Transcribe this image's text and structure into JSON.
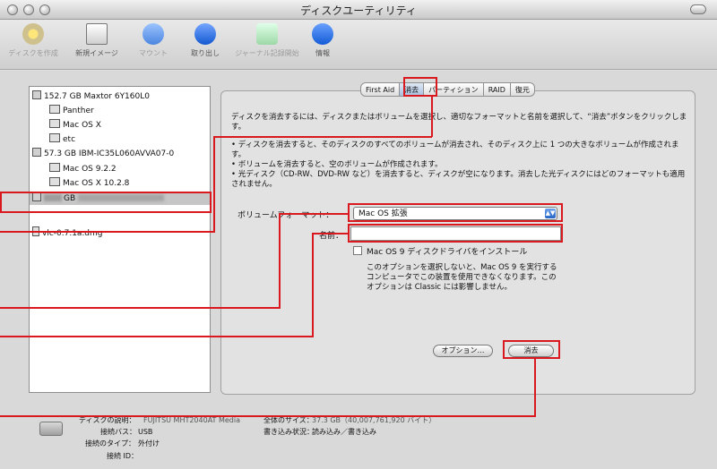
{
  "window": {
    "title": "ディスクユーティリティ"
  },
  "toolbar": {
    "items": [
      {
        "label": "ディスクを作成",
        "icon": "burn-icon",
        "enabled": false
      },
      {
        "label": "新規イメージ",
        "icon": "new-image-icon",
        "enabled": true
      },
      {
        "label": "マウント",
        "icon": "mount-icon",
        "enabled": false
      },
      {
        "label": "取り出し",
        "icon": "eject-icon",
        "enabled": true
      },
      {
        "label": "ジャーナル記録開始",
        "icon": "journal-icon",
        "enabled": false
      },
      {
        "label": "情報",
        "icon": "info-icon",
        "enabled": true
      }
    ]
  },
  "sidebar": {
    "items": [
      {
        "label": "152.7 GB Maxtor 6Y160L0",
        "level": "disk"
      },
      {
        "label": "Panther",
        "level": "volume"
      },
      {
        "label": "Mac OS X",
        "level": "volume"
      },
      {
        "label": "etc",
        "level": "volume"
      },
      {
        "label": "57.3 GB IBM-IC35L060AVVA07-0",
        "level": "disk"
      },
      {
        "label": "Mac OS 9.2.2",
        "level": "volume"
      },
      {
        "label": "Mac OS X 10.2.8",
        "level": "volume"
      },
      {
        "label": "GB",
        "level": "disk",
        "selected": true
      },
      {
        "label": "vlc-0.7.1a.dmg",
        "level": "image"
      }
    ]
  },
  "tabs": [
    "First Aid",
    "消去",
    "パーティション",
    "RAID",
    "復元"
  ],
  "erase": {
    "intro": "ディスクを消去するには、ディスクまたはボリュームを選択し、適切なフォーマットと名前を選択して、“消去”ボタンをクリックします。",
    "bullets": [
      "• ディスクを消去すると、そのディスクのすべてのボリュームが消去され、そのディスク上に 1 つの大きなボリュームが作成されます。",
      "• ボリュームを消去すると、空のボリュームが作成されます。",
      "• 光ディスク（CD-RW、DVD-RW など）を消去すると、ディスクが空になります。消去した光ディスクにはどのフォーマットも適用されません。"
    ],
    "format_label": "ボリュームフォーマット：",
    "format_value": "Mac OS 拡張",
    "name_label": "名前：",
    "name_value": "",
    "checkbox_label": "Mac OS 9 ディスクドライバをインストール",
    "checkbox_help": [
      "このオプションを選択しないと、Mac OS 9 を実行する",
      "コンピュータでこの装置を使用できなくなります。この",
      "オプションは Classic には影響しません。"
    ],
    "options_button": "オプション…",
    "erase_button": "消去"
  },
  "info": {
    "description_label": "ディスクの説明：",
    "description_value": "FUJITSU MHT2040AT Media",
    "bus_label": "接続バス：",
    "bus_value": "USB",
    "type_label": "接続のタイプ：",
    "type_value": "外付け",
    "id_label": "接続 ID：",
    "id_value": "",
    "total_label": "全体のサイズ：",
    "total_value": "37.3 GB（40,007,761,920 バイト）",
    "write_label": "書き込み状況：",
    "write_value": "読み込み／書き込み"
  }
}
